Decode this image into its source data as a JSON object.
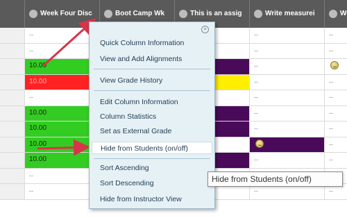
{
  "columns": [
    {
      "label": "Week Four Disc"
    },
    {
      "label": "Boot Camp Wk"
    },
    {
      "label": "This is an assig"
    },
    {
      "label": "Write measurei"
    },
    {
      "label": "Wedn"
    }
  ],
  "empty_marker": "--",
  "grade_value": "10.00",
  "colors": {
    "green": "#33cc22",
    "red": "#ff2222",
    "yellow": "#ffee00",
    "purple": "#4a0a5a",
    "menu_bg": "#e6f1f6",
    "header_bg": "#5a5a5a",
    "arrow": "#d8344a"
  },
  "context_menu": {
    "groups": [
      {
        "items": [
          "Quick Column Information",
          "View and Add Alignments"
        ]
      },
      {
        "items": [
          "View Grade History"
        ]
      },
      {
        "items": [
          "Edit Column Information",
          "Column Statistics",
          "Set as External Grade",
          "Hide from Students (on/off)"
        ]
      },
      {
        "items": [
          "Sort Ascending",
          "Sort Descending",
          "Hide from Instructor View"
        ]
      }
    ],
    "selected": "Hide from Students (on/off)"
  },
  "tooltip": "Hide from Students (on/off)"
}
